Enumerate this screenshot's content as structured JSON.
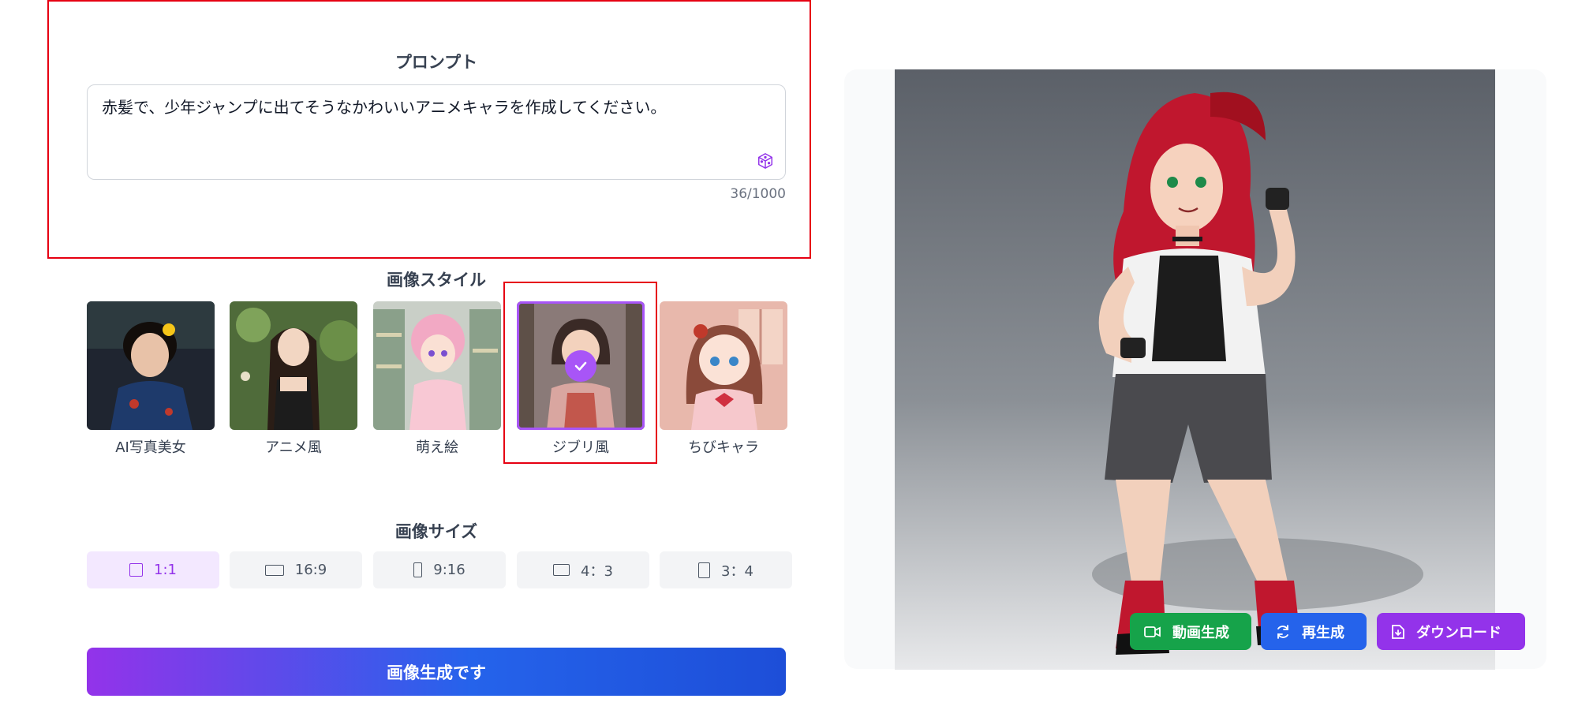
{
  "prompt": {
    "title": "プロンプト",
    "text": "赤髪で、少年ジャンプに出てそうなかわいいアニメキャラを作成してください。",
    "counter": "36/1000",
    "random_icon": "dice-icon"
  },
  "styles": {
    "title": "画像スタイル",
    "items": [
      {
        "label": "AI写真美女"
      },
      {
        "label": "アニメ風"
      },
      {
        "label": "萌え絵"
      },
      {
        "label": "ジブリ風",
        "selected": true
      },
      {
        "label": "ちびキャラ"
      }
    ]
  },
  "sizes": {
    "title": "画像サイズ",
    "items": [
      {
        "label": "1:1",
        "active": true
      },
      {
        "label": "16:9"
      },
      {
        "label": "9:16"
      },
      {
        "label": "4：3"
      },
      {
        "label": "3：4"
      }
    ]
  },
  "generate_button": "画像生成です",
  "actions": {
    "video": "動画生成",
    "regenerate": "再生成",
    "download": "ダウンロード"
  },
  "colors": {
    "accent": "#a855f7",
    "green": "#16a34a",
    "blue": "#2563eb",
    "purple": "#9333ea",
    "annotation": "#e60012"
  }
}
